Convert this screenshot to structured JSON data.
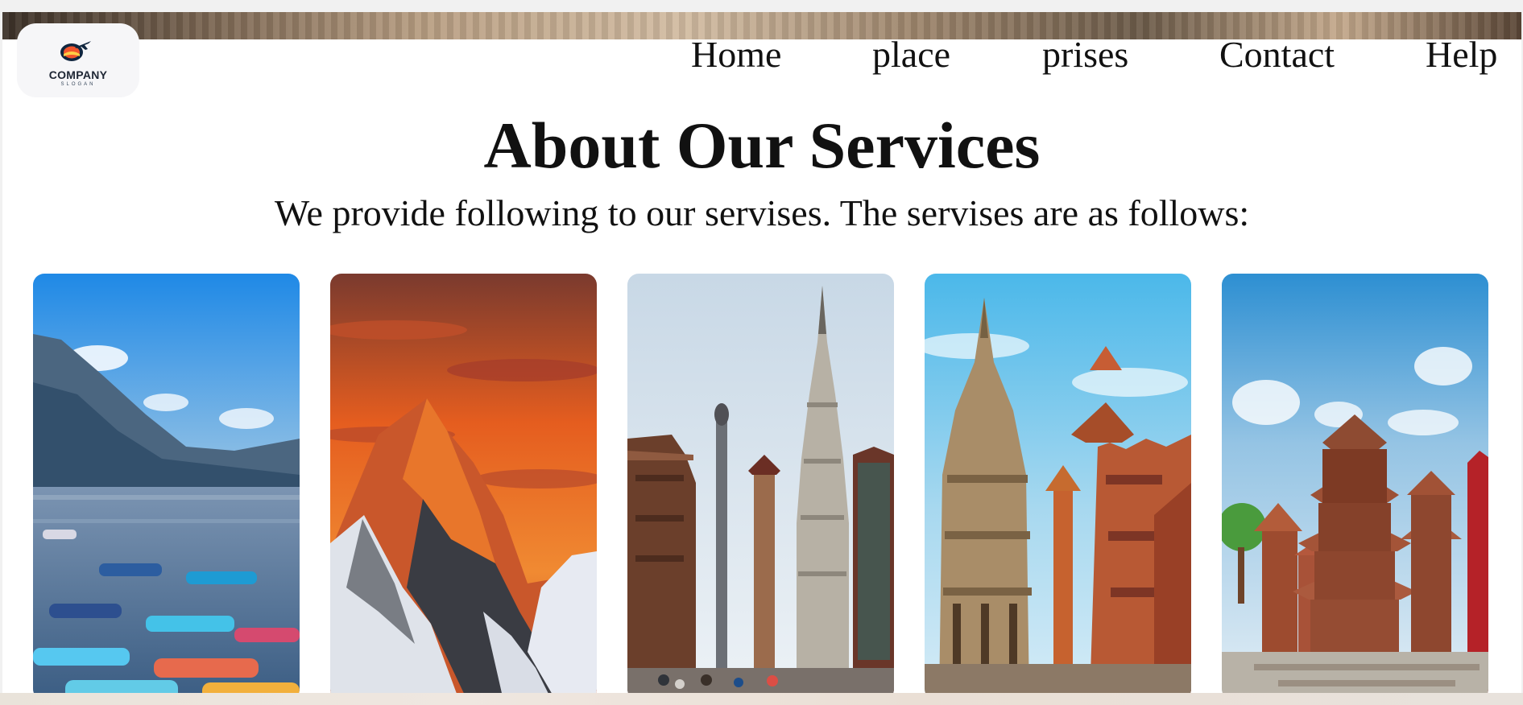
{
  "header": {
    "logo": {
      "name": "COMPANY",
      "slogan": "SLOGAN",
      "icon": "airplane-sunset-logo"
    },
    "nav": [
      {
        "label": "Home"
      },
      {
        "label": "place"
      },
      {
        "label": "prises"
      },
      {
        "label": "Contact"
      },
      {
        "label": "Help"
      }
    ]
  },
  "main": {
    "title": "About Our Services",
    "subtitle": "We provide following to our servises. The servises are as follows:"
  },
  "gallery": {
    "cards": [
      {
        "subject": "lake with colorful boats and mountains"
      },
      {
        "subject": "snow mountain peak at orange sunset"
      },
      {
        "subject": "stone shikhara temple in square"
      },
      {
        "subject": "stone temple and pagoda towers"
      },
      {
        "subject": "red brick pagoda temples"
      }
    ]
  },
  "colors": {
    "background": "#ffffff",
    "text": "#111111",
    "logo_background": "#f6f6f8"
  }
}
